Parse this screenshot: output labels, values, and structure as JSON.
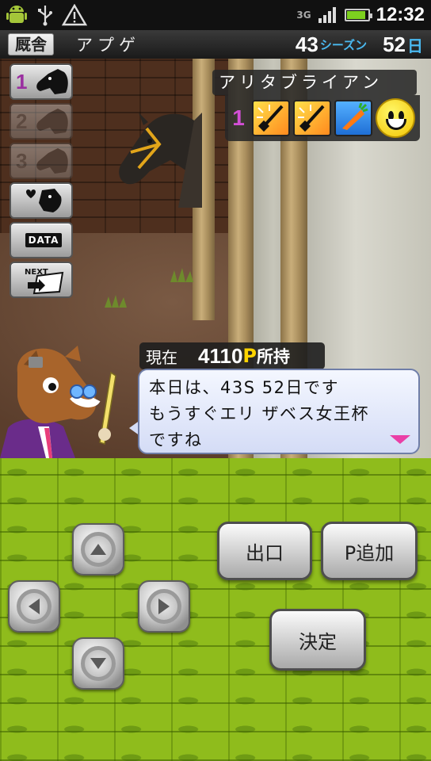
{
  "status_bar": {
    "network": "3G",
    "battery_level": 0.9,
    "time": "12:32"
  },
  "header": {
    "location": "厩舎",
    "subtitle": "アプゲ",
    "season_number": "43",
    "season_unit": "シーズン",
    "day_number": "52",
    "day_unit": "日"
  },
  "menu": {
    "slots": [
      {
        "number": "1",
        "enabled": true
      },
      {
        "number": "2",
        "enabled": false
      },
      {
        "number": "3",
        "enabled": false
      }
    ],
    "data_label": "DATA",
    "next_label": "NEXT"
  },
  "horse": {
    "name": "アリタブライアン",
    "rank": "1",
    "items": [
      "whip-icon",
      "whip-icon",
      "carrot-icon"
    ],
    "mood": "smiley-icon"
  },
  "dialogue": {
    "points_label": "現在",
    "points_value": "4110",
    "points_unit": "P",
    "points_suffix": "所持",
    "lines": [
      "本日は、43S 52日です",
      "もうすぐエリ ザベス女王杯",
      "ですね"
    ]
  },
  "controls": {
    "exit_label": "出口",
    "add_points_label": "P追加",
    "confirm_label": "決定"
  },
  "colors": {
    "accent_purple": "#9a2fa0",
    "season_blue": "#4ab9f0",
    "points_yellow": "#ffd400",
    "pad_green": "#8fbc1c"
  }
}
